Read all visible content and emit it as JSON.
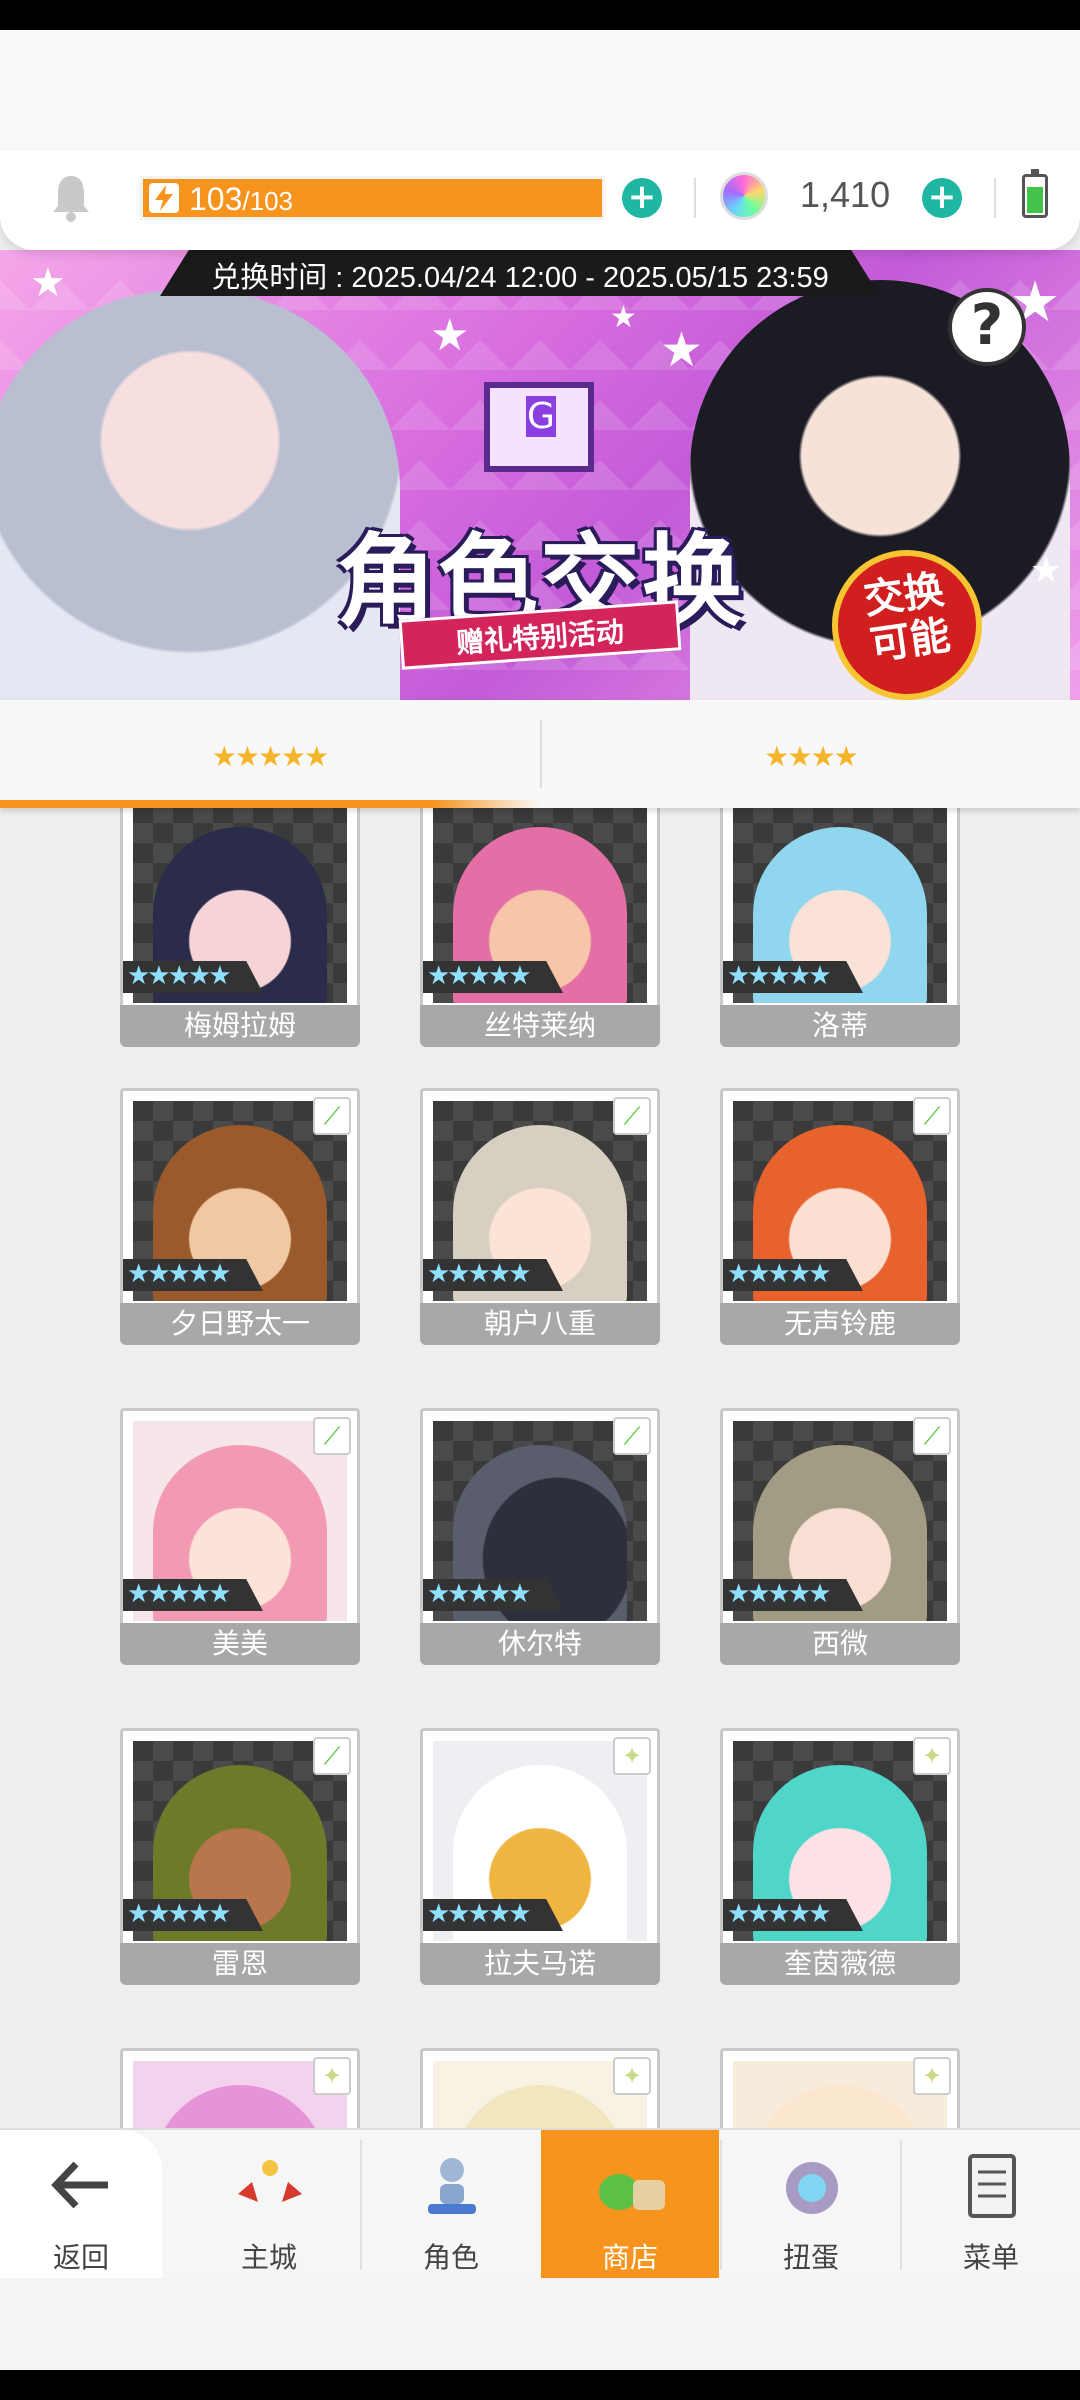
{
  "resources": {
    "energy_current": "103",
    "energy_max": "/103",
    "energy_fraction": 1.0,
    "gem_count": "1,410"
  },
  "banner": {
    "exchange_time": "兑换时间 : 2025.04/24 12:00 - 2025.05/15 23:59",
    "title": "角色交换",
    "subtitle": "赠礼特别活动",
    "badge": "交换\n可能",
    "help": "?"
  },
  "tabs": [
    {
      "label": "★★★★★",
      "active": true
    },
    {
      "label": "★★★★",
      "active": false
    }
  ],
  "characters": [
    {
      "name": "梅姆拉姆",
      "rarity": "★★★★★",
      "element": "leaf-icon"
    },
    {
      "name": "丝特莱纳",
      "rarity": "★★★★★",
      "element": "lightning-icon"
    },
    {
      "name": "洛蒂",
      "rarity": "★★★★★",
      "element": "lightning-icon"
    },
    {
      "name": "夕日野太一",
      "rarity": "★★★★★",
      "element": "leaf-icon"
    },
    {
      "name": "朝户八重",
      "rarity": "★★★★★",
      "element": "leaf-icon"
    },
    {
      "name": "无声铃鹿",
      "rarity": "★★★★★",
      "element": "leaf-icon"
    },
    {
      "name": "美美",
      "rarity": "★★★★★",
      "element": "leaf-icon"
    },
    {
      "name": "休尔特",
      "rarity": "★★★★★",
      "element": "leaf-icon"
    },
    {
      "name": "西微",
      "rarity": "★★★★★",
      "element": "leaf-icon"
    },
    {
      "name": "雷恩",
      "rarity": "★★★★★",
      "element": "leaf-icon"
    },
    {
      "name": "拉夫马诺",
      "rarity": "★★★★★",
      "element": "light-star-icon"
    },
    {
      "name": "奎茵薇德",
      "rarity": "★★★★★",
      "element": "light-star-icon"
    },
    {
      "name": "",
      "rarity": "",
      "element": "light-star-icon"
    },
    {
      "name": "",
      "rarity": "",
      "element": "light-star-icon"
    },
    {
      "name": "",
      "rarity": "",
      "element": "light-star-icon"
    }
  ],
  "nav": {
    "back": "返回",
    "items": [
      {
        "label": "主城",
        "icon": "castle-icon"
      },
      {
        "label": "角色",
        "icon": "character-icon"
      },
      {
        "label": "商店",
        "icon": "shop-icon",
        "active": true
      },
      {
        "label": "扭蛋",
        "icon": "gacha-icon"
      },
      {
        "label": "菜单",
        "icon": "menu-icon"
      }
    ]
  }
}
